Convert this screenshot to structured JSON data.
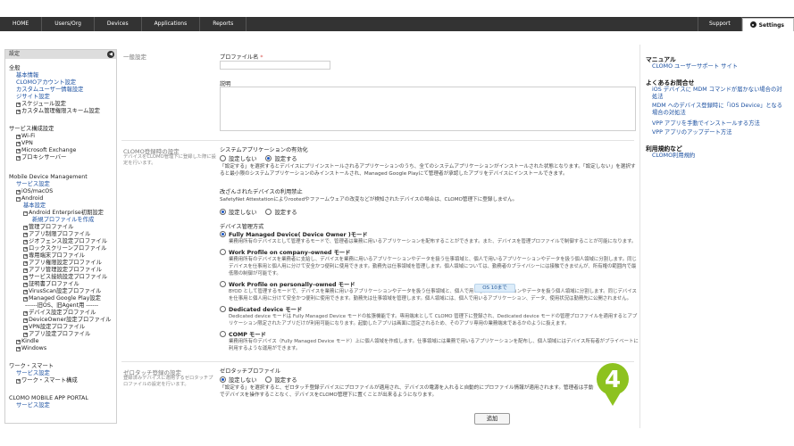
{
  "topnav": {
    "items": [
      "HOME",
      "Users/Org",
      "Devices",
      "Applications",
      "Reports"
    ],
    "support": "Support",
    "settings": "Settings"
  },
  "sidebar": {
    "header": "設定",
    "zenpan": "全般",
    "kihon": "基本情報",
    "clomo_account": "CLOMOアカウント設定",
    "custom_user": "カスタムユーザー情報設定",
    "jisite": "ジサイト設定",
    "schedule": "スケジュール設定",
    "custom_kanri": "カスタム管理権限スキーム設定",
    "service_koseisettei": "サービス構成設定",
    "wifi": "Wi-Fi",
    "vpn": "VPN",
    "exchange": "Microsoft Exchange",
    "proxy": "プロキシサーバー",
    "mdm": "Mobile Device Management",
    "service_settei": "サービス設定",
    "ios_macos": "iOS/macOS",
    "android": "Android",
    "android_kihon": "基本設定",
    "aep": "Android Enterprise初期設定",
    "new_profile": "新規プロファイルを作成",
    "kanri_profile": "管理プロファイル",
    "app_seigen": "アプリ制限プロファイル",
    "geofence": "ジオフェンス設定プロファイル",
    "lockscreen": "ロックスクリーンプロファイル",
    "senyo": "専用端末プロファイル",
    "app_kengen": "アプリ権限設定プロファイル",
    "app_kanri": "アプリ管理設定プロファイル",
    "service_setsuzoku": "サービス接続設定プロファイル",
    "shomeisho": "証明書プロファイル",
    "virusscan": "VirusScan設定プロファイル",
    "managed_gp": "Managed Google Play設定",
    "old_agent": "------旧OS、旧Agent用 ------",
    "device_settei": "デバイス設定プロファイル",
    "device_owner": "DeviceOwner設定プロファイル",
    "vpn_settei": "VPN設定プロファイル",
    "app_settei": "アプリ設定プロファイル",
    "kindle": "Kindle",
    "windows": "Windows",
    "work_smart": "ワーク・スマート",
    "ws_service": "サービス設定",
    "ws_kosei": "ワーク・スマート構成",
    "portal": "CLOMO MOBILE APP PORTAL",
    "portal_service": "サービス設定"
  },
  "main": {
    "general_label": "一般設定",
    "profile_name_label": "プロファイル名",
    "required_mark": "*",
    "description_label": "説明",
    "reg_section_label": "CLOMO登録時の設定",
    "reg_section_desc": "デバイスをCLOMO管理下に登録した際に設定を行います。",
    "sysapp_label": "システムアプリケーションの有効化",
    "opt_off": "設定しない",
    "opt_on": "設定する",
    "sysapp_note": "「設定する」を選択するとデバイスにプリインストールされるアプリケーションのうち、全てのシステムアプリケーションがインストールされた状態となります。「設定しない」を選択すると最小限のシステムアプリケーションのみインストールされ、Managed Google Playにて管理者が承認したアプリをデバイスにインストールできます。",
    "tamper_label": "改ざんされたデバイスの利用禁止",
    "tamper_note": "SafetyNet Attestationによりrootedやファームウェアの改変などが検知されたデバイスの場合は、CLOMO管理下に登録しません。",
    "mgmt_label": "デバイス管理方式",
    "mode1_title": "Fully Managed Device( Device Owner )モード",
    "mode1_desc": "業務用所有のデバイスとして管理するモードで、管理者は業務に用いるアプリケーションを配布することができます。また、デバイスを管理プロファイルで制御することが可能になります。",
    "mode2_title": "Work Profile on company–owned モード",
    "mode2_desc": "業務用所有のデバイスを業務者に支給し、デバイスを業務に用いるアプリケーションやデータを扱う仕事領域と、個人で用いるアプリケーションやデータを扱う個人領域に分割します。同じデバイスを仕事用と個人用に分けて安全かつ便利に使用できます。勤務先は仕事領域を管理します。個人領域については、勤務者のプライバシーには接触できませんが、所有権の範囲内で最低限の制御が可能です。",
    "mode3_title": "Work Profile on personally–owned モード",
    "mode3_desc": "BYOD として管理するモードで、デバイスを業務に用いるアプリケーションやデータを扱う仕事領域と、個人で用いるアプリケーションやデータを扱う個人領域に分割します。同じデバイスを仕事用と個人用に分けて安全かつ便利に使用できます。勤務先は仕事領域を管理します。個人領域には、個人で用いるアプリケーション、データ、使用状況は勤務先に公開されません。",
    "mode4_title": "Dedicated device モード",
    "mode4_desc": "Dedicated device モードは Fully Managed Device モードの拡張機能です。専用端末として CLOMO 管理下に登録され、Dedicated device モードの管理プロファイルを適用するとアプリケーション限定されたアプリだけが利用可能になります。起動したアプリは画面に固定されるため、そのアプリ専用の業務端末であるかのように扱えます。",
    "mode5_title": "COMP モード",
    "mode5_desc": "業務用所有のデバイス（Fully Managed Device モード）上に個人領域を作成します。仕事領域には業務で用いるアプリケーションを配布し、個人領域にはデバイス所有者がプライベートに利用するような運用ができます。",
    "os_badge": "OS 10まで",
    "zerotouch_label": "ゼロタッチ登録の設定",
    "zerotouch_desc": "登録済みデバイスに適用するゼロタッチプロファイルの設定を行います。",
    "zt_profile_label": "ゼロタッチプロファイル",
    "zt_note": "「設定する」を選択すると、ゼロタッチ登録デバイスにプロファイルが適用され、デバイスの電源を入れると自動的にプロファイル情報が適用されます。管理者は手動でデバイスを操作することなく、デバイスをCLOMO管理下に置くことが出来るようになります。",
    "add_button": "追加",
    "step_number": "4"
  },
  "rightpanel": {
    "manual_head": "マニュアル",
    "manual_link": "CLOMO ユーザーサポート サイト",
    "faq_head": "よくあるお問合せ",
    "faq1": "iOS デバイスに MDM コマンドが届かない場合の対処法",
    "faq2": "MDM へのデバイス登録時に「iOS Device」となる場合の対処法",
    "faq3": "VPP アプリを手動でインストールする方法",
    "faq4": "VPP アプリのアップデート方法",
    "terms_head": "利用規約など",
    "terms_link": "CLOMO利用規約"
  },
  "colors": {
    "topbar": "#333333",
    "link": "#1a4fa0",
    "marker": "#8dc21f",
    "required": "#d9534f"
  }
}
